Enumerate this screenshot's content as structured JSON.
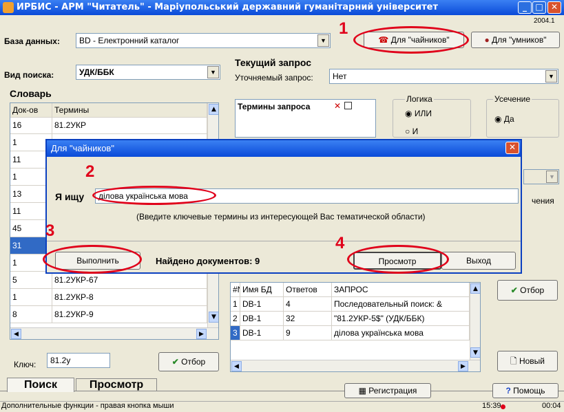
{
  "window": {
    "title": "ИРБИС - АРМ \"Читатель\" - Маріупольський державний гуманітарний університет",
    "version": "2004.1"
  },
  "toolbar": {
    "db_label": "База данных:",
    "db_value": "BD - Електронний каталог",
    "btn_beginners": "Для \"чайников\"",
    "btn_advanced": "Для \"умников\""
  },
  "search": {
    "type_label": "Вид поиска:",
    "type_value": "УДК/ББК",
    "vocab_title": "Словарь",
    "col_docs": "Док-ов",
    "col_terms": "Термины",
    "rows": [
      {
        "docs": "16",
        "term": "81.2УКР"
      },
      {
        "docs": "1",
        "term": ""
      },
      {
        "docs": "11",
        "term": ""
      },
      {
        "docs": "1",
        "term": ""
      },
      {
        "docs": "13",
        "term": ""
      },
      {
        "docs": "11",
        "term": ""
      },
      {
        "docs": "45",
        "term": ""
      },
      {
        "docs": "31",
        "term": ""
      },
      {
        "docs": "1",
        "term": ""
      },
      {
        "docs": "5",
        "term": "81.2УКР-67"
      },
      {
        "docs": "1",
        "term": "81.2УКР-8"
      },
      {
        "docs": "8",
        "term": "81.2УКР-9"
      }
    ],
    "key_label": "Ключ:",
    "key_value": "81.2у",
    "select_button": "Отбор"
  },
  "query": {
    "title": "Текущий запрос",
    "refine_label": "Уточняемый запрос:",
    "refine_value": "Нет",
    "terms_header": "Термины запроса",
    "logic_title": "Логика",
    "logic_or": "ИЛИ",
    "logic_and": "И",
    "trunc_title": "Усечение",
    "trunc_yes": "Да",
    "partial_label": "чения"
  },
  "history": {
    "col_n": "#N",
    "col_db": "Имя БД",
    "col_answers": "Ответов",
    "col_query": "ЗАПРОС",
    "rows": [
      {
        "n": "1",
        "db": "DB-1",
        "answers": "4",
        "query": "Последовательный поиск: &"
      },
      {
        "n": "2",
        "db": "DB-1",
        "answers": "32",
        "query": "\"81.2УКР-5$\" (УДК/ББК)"
      },
      {
        "n": "3",
        "db": "DB-1",
        "answers": "9",
        "query": "ділова українська мова"
      }
    ],
    "select_button": "Отбор",
    "new_button": "Новый"
  },
  "tabs": [
    "Поиск",
    "Просмотр"
  ],
  "bottom": {
    "register_button": "Регистрация",
    "help_button": "Помощь",
    "status_text": "Дополнительные функции - правая кнопка мыши",
    "time": "15:39",
    "elapsed": "00:04"
  },
  "dialog": {
    "title": "Для \"чайников\"",
    "search_label": "Я ищу",
    "search_value": "ділова українська мова",
    "hint": "(Введите ключевые термины из интересующей Вас тематической области)",
    "run_button": "Выполнить",
    "found_text": "Найдено документов: 9",
    "view_button": "Просмотр",
    "exit_button": "Выход"
  },
  "annotations": [
    "1",
    "2",
    "3",
    "4"
  ],
  "colors": {
    "accent_red": "#e0001a",
    "title_blue": "#0a4ad8",
    "window_bg": "#ece9d8"
  }
}
